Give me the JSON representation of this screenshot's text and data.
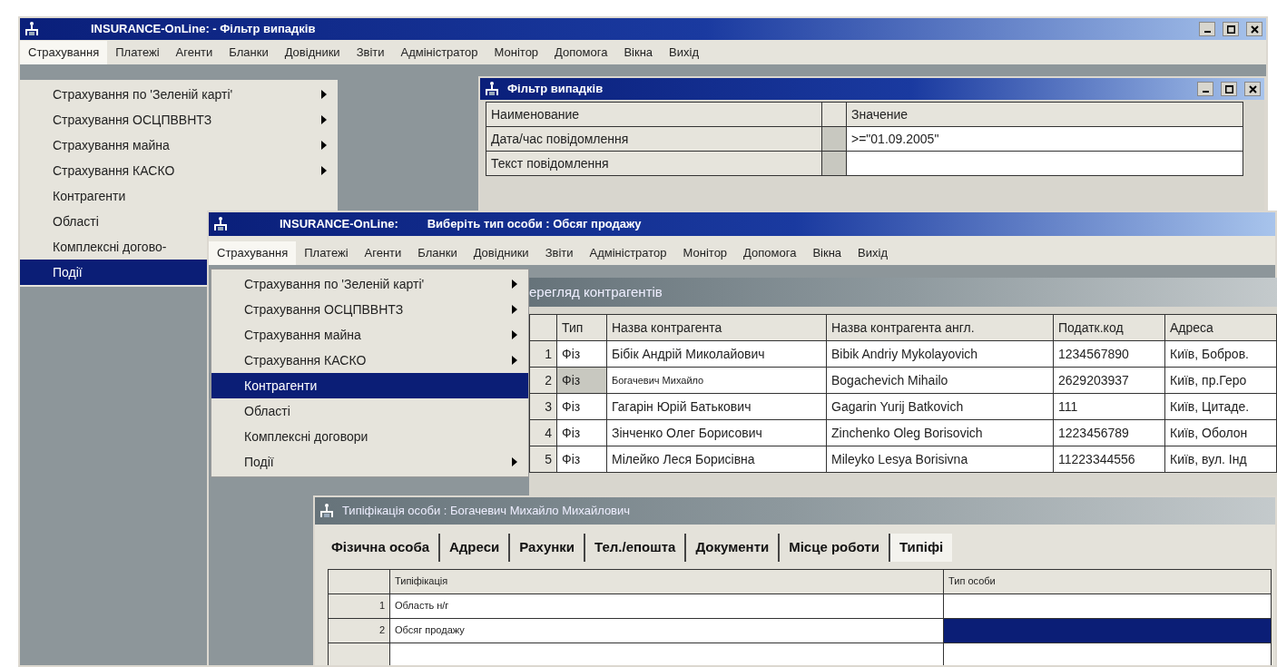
{
  "main_window": {
    "title": "INSURANCE-OnLine:  - Фільтр випадків",
    "menu": [
      {
        "label": "Страхування",
        "selected": true
      },
      {
        "label": "Платежі",
        "selected": false
      },
      {
        "label": "Агенти",
        "selected": false
      },
      {
        "label": "Бланки",
        "selected": false
      },
      {
        "label": "Довідники",
        "selected": false
      },
      {
        "label": "Звіти",
        "selected": false
      },
      {
        "label": "Адміністратор",
        "selected": false
      },
      {
        "label": "Монітор",
        "selected": false
      },
      {
        "label": "Допомога",
        "selected": false
      },
      {
        "label": "Вікна",
        "selected": false
      },
      {
        "label": "Вихід",
        "selected": false
      }
    ],
    "dropdown": [
      {
        "label": "Страхування по 'Зеленій карті'",
        "submenu": true,
        "selected": false
      },
      {
        "label": "Страхування ОСЦПВВНТЗ",
        "submenu": true,
        "selected": false
      },
      {
        "label": "Страхування майна",
        "submenu": true,
        "selected": false
      },
      {
        "label": "Страхування КАСКО",
        "submenu": true,
        "selected": false
      },
      {
        "label": "Контрагенти",
        "submenu": false,
        "selected": false
      },
      {
        "label": "Області",
        "submenu": false,
        "selected": false
      },
      {
        "label": "Комплексні догово-",
        "submenu": false,
        "selected": false
      },
      {
        "label": "Події",
        "submenu": false,
        "selected": true
      }
    ]
  },
  "filter_window": {
    "title": "Фільтр випадків",
    "columns": [
      "Наименование",
      "Значение"
    ],
    "rows": [
      {
        "name": "Дата/час повідомлення",
        "value": ">=\"01.09.2005\""
      },
      {
        "name": "Текст повідомлення"
      }
    ]
  },
  "selection_window": {
    "title": "INSURANCE-OnLine:",
    "subtitle": "Виберіть тип особи : Обсяг продажу",
    "menu": [
      {
        "label": "Страхування",
        "selected": true
      },
      {
        "label": "Платежі",
        "selected": false
      },
      {
        "label": "Агенти",
        "selected": false
      },
      {
        "label": "Бланки",
        "selected": false
      },
      {
        "label": "Довідники",
        "selected": false
      },
      {
        "label": "Звіти",
        "selected": false
      },
      {
        "label": "Адміністратор",
        "selected": false
      },
      {
        "label": "Монітор",
        "selected": false
      },
      {
        "label": "Допомога",
        "selected": false
      },
      {
        "label": "Вікна",
        "selected": false
      },
      {
        "label": "Вихід",
        "selected": false
      }
    ],
    "dropdown": [
      {
        "label": "Страхування по 'Зеленій карті'",
        "submenu": true,
        "selected": false
      },
      {
        "label": "Страхування ОСЦПВВНТЗ",
        "submenu": true,
        "selected": false
      },
      {
        "label": "Страхування майна",
        "submenu": true,
        "selected": false
      },
      {
        "label": "Страхування КАСКО",
        "submenu": true,
        "selected": false
      },
      {
        "label": "Контрагенти",
        "submenu": false,
        "selected": true
      },
      {
        "label": "Області",
        "submenu": false,
        "selected": false
      },
      {
        "label": "Комплексні договори",
        "submenu": false,
        "selected": false
      },
      {
        "label": "Події",
        "submenu": true,
        "selected": false
      }
    ]
  },
  "contractors_window": {
    "title": "ерегляд контрагентів",
    "columns": [
      "Тип",
      "Назва контрагента",
      "Назва контрагента англ.",
      "Податк.код",
      "Адреса"
    ],
    "rows": [
      {
        "number": "1",
        "cells": [
          "Фіз",
          "Бібік Андрій Миколайович",
          "Bibik Andriy Mykolayovich",
          "1234567890",
          "Київ, Бобров."
        ],
        "selected": false
      },
      {
        "number": "2",
        "cells": [
          "Фіз",
          "Богачевич Михайло",
          "Bogachevich Mihailo",
          "2629203937",
          "Київ, пр.Геро"
        ],
        "selected": true
      },
      {
        "number": "3",
        "cells": [
          "Фіз",
          "Гагарін Юрій Батькович",
          "Gagarin Yurij Batkovich",
          "111",
          "Київ, Цитаде."
        ],
        "selected": false
      },
      {
        "number": "4",
        "cells": [
          "Фіз",
          "Зінченко Олег Борисович",
          "Zinchenko Oleg Borisovich",
          "1223456789",
          "Київ, Оболон"
        ],
        "selected": false
      },
      {
        "number": "5",
        "cells": [
          "Фіз",
          "Мілейко Леся Борисівна",
          "Mileyko Lesya Borisivna",
          "11223344556",
          "Київ, вул. Інд"
        ],
        "selected": false
      }
    ]
  },
  "typification_window": {
    "title": "Типіфікація особи : Богачевич Михайло Михайлович",
    "tabs": [
      {
        "label": "Фізична особа",
        "selected": false
      },
      {
        "label": "Адреси",
        "selected": false
      },
      {
        "label": "Рахунки",
        "selected": false
      },
      {
        "label": "Тел./епошта",
        "selected": false
      },
      {
        "label": "Документи",
        "selected": false
      },
      {
        "label": "Місце роботи",
        "selected": false
      },
      {
        "label": "Типіфі",
        "selected": true
      }
    ],
    "columns": [
      "Типіфікація",
      "Тип особи"
    ],
    "rows": [
      {
        "number": "1",
        "typification": "Область н/г",
        "selected": false
      },
      {
        "number": "2",
        "typification": "Обсяг продажу",
        "selected": true
      }
    ]
  }
}
